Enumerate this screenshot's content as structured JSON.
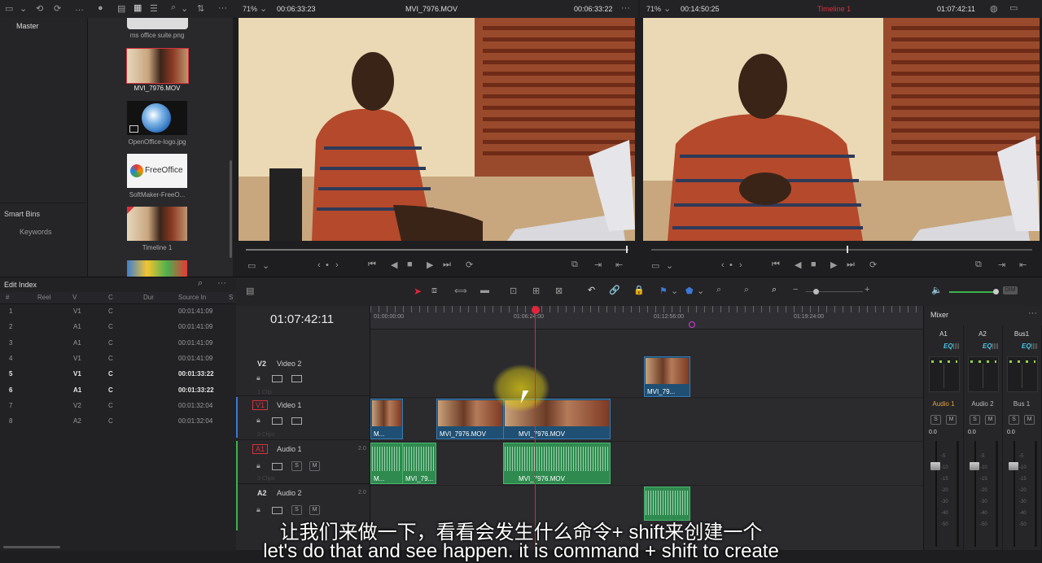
{
  "viewer_left": {
    "zoom": "71%",
    "timecode_in": "00:06:33:23",
    "clip_name": "MVI_7976.MOV",
    "timecode_out": "00:06:33:22"
  },
  "viewer_right": {
    "zoom": "71%",
    "timecode_in": "00:14:50:25",
    "timeline_name": "Timeline 1",
    "timecode_out": "01:07:42:11"
  },
  "bins": {
    "master": "Master",
    "smart_bins": "Smart Bins",
    "keywords": "Keywords"
  },
  "media": [
    {
      "name": "ms office suite.png"
    },
    {
      "name": "MVI_7976.MOV"
    },
    {
      "name": "OpenOffice-logo.jpg"
    },
    {
      "name": "SoftMaker-FreeO...",
      "logo_text": "FreeOffice"
    },
    {
      "name": "Timeline 1"
    }
  ],
  "edit_index": {
    "title": "Edit Index",
    "columns": [
      "#",
      "Reel",
      "V",
      "C",
      "Dur",
      "Source In",
      "S"
    ],
    "rows": [
      {
        "n": "1",
        "v": "V1",
        "c": "C",
        "src": "00:01:41:09",
        "bold": false
      },
      {
        "n": "2",
        "v": "A1",
        "c": "C",
        "src": "00:01:41:09",
        "bold": false
      },
      {
        "n": "3",
        "v": "A1",
        "c": "C",
        "src": "00:01:41:09",
        "bold": false
      },
      {
        "n": "4",
        "v": "V1",
        "c": "C",
        "src": "00:01:41:09",
        "bold": false
      },
      {
        "n": "5",
        "v": "V1",
        "c": "C",
        "src": "00:01:33:22",
        "bold": true
      },
      {
        "n": "6",
        "v": "A1",
        "c": "C",
        "src": "00:01:33:22",
        "bold": true
      },
      {
        "n": "7",
        "v": "V2",
        "c": "C",
        "src": "00:01:32:04",
        "bold": false
      },
      {
        "n": "8",
        "v": "A2",
        "c": "C",
        "src": "00:01:32:04",
        "bold": false
      }
    ]
  },
  "timeline": {
    "timecode": "01:07:42:11",
    "ruler": [
      "01:00:00:00",
      "01:06:24:00",
      "01:12:56:00",
      "01:19:24:00"
    ],
    "tracks": {
      "v2": {
        "id": "V2",
        "name": "Video 2"
      },
      "v1": {
        "id": "V1",
        "name": "Video 1",
        "clips": "3 Clips"
      },
      "v2_clips": "1 Clip",
      "a1": {
        "id": "A1",
        "name": "Audio 1",
        "level": "2.0",
        "clips": "3 Clips"
      },
      "a2": {
        "id": "A2",
        "name": "Audio 2",
        "level": "2.0"
      }
    },
    "clip_labels": {
      "v1_a": "M...",
      "v1_b": "MVI_7976.MOV",
      "v1_c": "MVI_7976.MOV",
      "v2_a": "MVI_79...",
      "a1_a": "M...",
      "a1_b": "MVI_79...",
      "a1_c": "MVI_7976.MOV"
    },
    "track_button_s": "S",
    "track_button_m": "M"
  },
  "mixer": {
    "title": "Mixer",
    "channels": [
      {
        "name": "A1",
        "eq": "EQ",
        "strip": "Audio 1",
        "level": "0.0",
        "active": true
      },
      {
        "name": "A2",
        "eq": "EQ",
        "strip": "Audio 2",
        "level": "0.0",
        "active": false
      },
      {
        "name": "Bus1",
        "eq": "EQ",
        "strip": "Bus 1",
        "level": "0.0",
        "active": false
      }
    ],
    "button_s": "S",
    "button_m": "M",
    "scale": [
      "-5",
      "-10",
      "-15",
      "-20",
      "-30",
      "-40",
      "-50"
    ],
    "dim_label": "DIM"
  },
  "subtitle": {
    "line1": "让我们来做一下，看看会发生什么命令+ shift来创建一个",
    "line2": "let's do that and see happen. it is command + shift to create"
  },
  "colors": {
    "playhead": "#e0253a",
    "video_clip": "#1f4f73",
    "audio_clip": "#2f8a4f",
    "accent_red": "#d8323c"
  }
}
